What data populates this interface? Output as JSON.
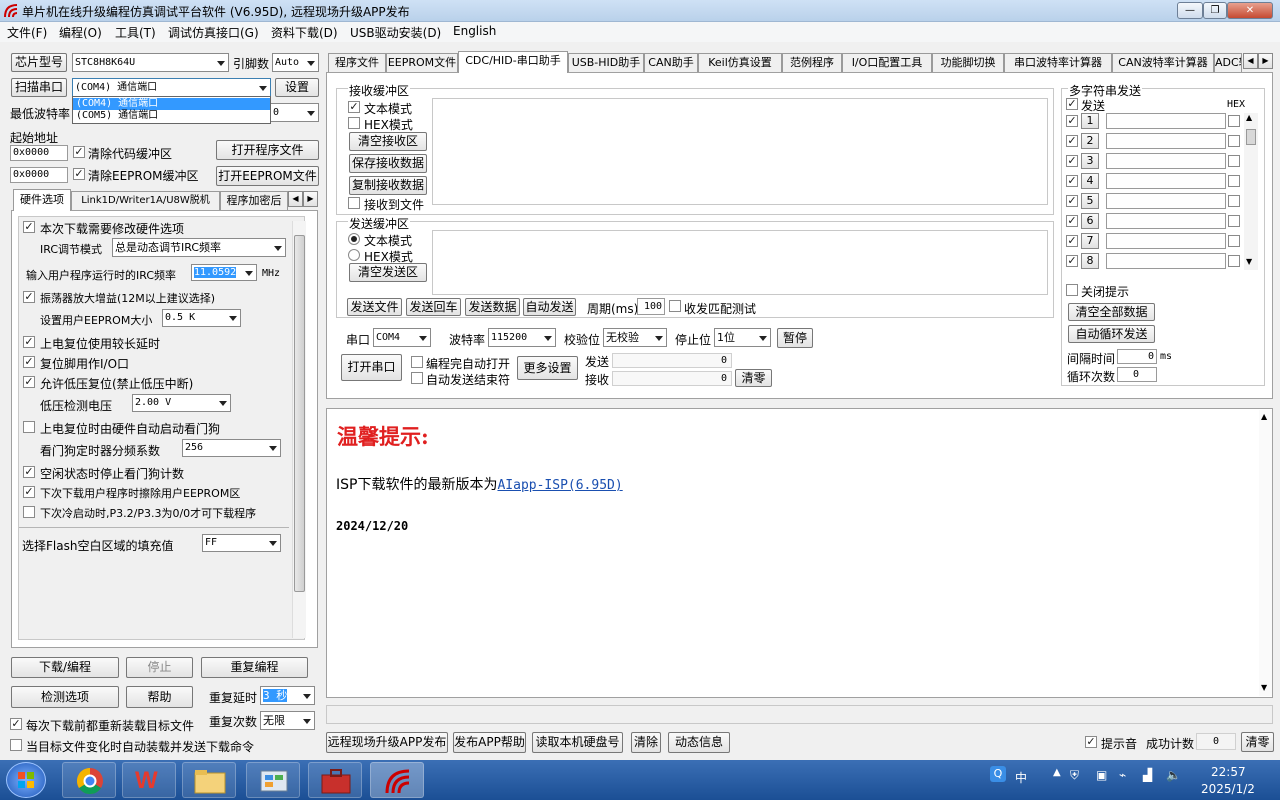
{
  "window": {
    "title": "单片机在线升级编程仿真调试平台软件 (V6.95D), 远程现场升级APP发布"
  },
  "menu": [
    "文件(F)",
    "编程(O)",
    "工具(T)",
    "调试仿真接口(G)",
    "资料下载(D)",
    "USB驱动安装(D)",
    "English"
  ],
  "left": {
    "chip_btn": "芯片型号",
    "chip_value": "STC8H8K64U",
    "pin_label": "引脚数",
    "pin_value": "Auto",
    "scan_btn": "扫描串口",
    "port_value": "(COM4) 通信端口",
    "settings_btn": "设置",
    "dropdown": [
      "(COM4) 通信端口",
      "(COM5) 通信端口"
    ],
    "min_baud_label": "最低波特率",
    "min_baud_value": "0",
    "start_addr_label": "起始地址",
    "addr1": "0x0000",
    "clear_code": "清除代码缓冲区",
    "open_prog_btn": "打开程序文件",
    "addr2": "0x0000",
    "clear_eeprom": "清除EEPROM缓冲区",
    "open_eeprom_btn": "打开EEPROM文件",
    "tabs": [
      "硬件选项",
      "Link1D/Writer1A/U8W脱机",
      "程序加密后"
    ],
    "hw": {
      "opt1": "本次下载需要修改硬件选项",
      "irc_mode_label": "IRC调节模式",
      "irc_mode_value": "总是动态调节IRC频率",
      "irc_freq_label": "输入用户程序运行时的IRC频率",
      "irc_freq_value": "11.0592",
      "irc_unit": "MHz",
      "opt2": "振荡器放大增益(12M以上建议选择)",
      "eeprom_size_label": "设置用户EEPROM大小",
      "eeprom_size_value": "0.5 K",
      "opt3": "上电复位使用较长延时",
      "opt4": "复位脚用作I/O口",
      "opt5": "允许低压复位(禁止低压中断)",
      "lvd_label": "低压检测电压",
      "lvd_value": "2.00 V",
      "opt6": "上电复位时由硬件自动启动看门狗",
      "wdt_label": "看门狗定时器分频系数",
      "wdt_value": "256",
      "opt7": "空闲状态时停止看门狗计数",
      "opt8": "下次下载用户程序时擦除用户EEPROM区",
      "opt9": "下次冷启动时,P3.2/P3.3为0/0才可下载程序",
      "fill_label": "选择Flash空白区域的填充值",
      "fill_value": "FF"
    },
    "download_btn": "下载/编程",
    "stop_btn": "停止",
    "reprog_btn": "重复编程",
    "check_btn": "检测选项",
    "help_btn": "帮助",
    "delay_label": "重复延时",
    "delay_value": "3 秒",
    "count_label": "重复次数",
    "count_value": "无限",
    "reload_chk": "每次下载前都重新装载目标文件",
    "auto_chk": "当目标文件变化时自动装载并发送下载命令"
  },
  "tabs": [
    "程序文件",
    "EEPROM文件",
    "CDC/HID-串口助手",
    "USB-HID助手",
    "CAN助手",
    "Keil仿真设置",
    "范例程序",
    "I/O口配置工具",
    "功能脚切换",
    "串口波特率计算器",
    "CAN波特率计算器",
    "ADC转"
  ],
  "serial": {
    "recv_title": "接收缓冲区",
    "text_mode": "文本模式",
    "hex_mode": "HEX模式",
    "clear_recv": "清空接收区",
    "save_recv": "保存接收数据",
    "copy_recv": "复制接收数据",
    "recv_to_file": "接收到文件",
    "send_title": "发送缓冲区",
    "clear_send": "清空发送区",
    "send_file": "发送文件",
    "send_return": "发送回车",
    "send_data": "发送数据",
    "auto_send": "自动发送",
    "period_label": "周期(ms)",
    "period_value": "100",
    "match_test": "收发匹配测试",
    "port_label": "串口",
    "port_value": "COM4",
    "baud_label": "波特率",
    "baud_value": "115200",
    "parity_label": "校验位",
    "parity_value": "无校验",
    "stop_label": "停止位",
    "stop_value": "1位",
    "pause_btn": "暂停",
    "open_port_btn": "打开串口",
    "auto_open": "编程完自动打开",
    "auto_end": "自动发送结束符",
    "more_btn": "更多设置",
    "send_count_label": "发送",
    "send_count": "0",
    "recv_count_label": "接收",
    "recv_count": "0",
    "clear_count_btn": "清零"
  },
  "multi": {
    "title": "多字符串发送",
    "send_hdr": "发送",
    "hex_hdr": "HEX",
    "rows": [
      "1",
      "2",
      "3",
      "4",
      "5",
      "6",
      "7",
      "8"
    ],
    "close_tip": "关闭提示",
    "clear_all": "清空全部数据",
    "auto_loop": "自动循环发送",
    "interval_label": "间隔时间",
    "interval_value": "0",
    "interval_unit": "ms",
    "loop_label": "循环次数",
    "loop_value": "0"
  },
  "info": {
    "heading": "温馨提示:",
    "line_prefix": "ISP下载软件的最新版本为",
    "link": "AIapp-ISP(6.95D)",
    "date": "2024/12/20"
  },
  "bottom": {
    "publish_btn": "远程现场升级APP发布",
    "publish_help": "发布APP帮助",
    "read_disk": "读取本机硬盘号",
    "clear_btn": "清除",
    "dynamic_btn": "动态信息",
    "beep_label": "提示音",
    "success_label": "成功计数",
    "success_value": "0",
    "reset_btn": "清零"
  },
  "taskbar": {
    "time": "22:57",
    "date": "2025/1/2",
    "ime": "中"
  },
  "colors": {
    "heading_red": "#e02020",
    "link_blue": "#1a4fb0",
    "taskbar": "#2a5fa5",
    "selection": "#3399ff"
  }
}
